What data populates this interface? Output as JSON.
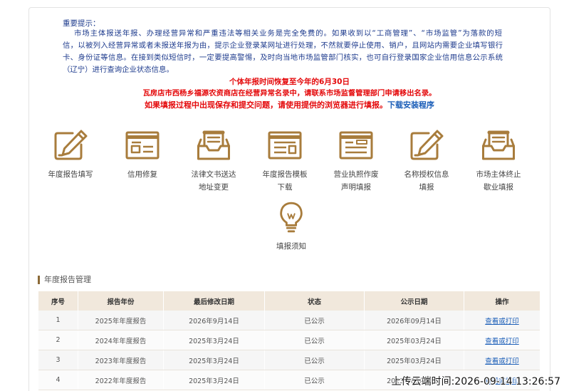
{
  "colors": {
    "notice_text": "#1f3c8e",
    "alert_red": "#e4080a",
    "link_blue": "#1b5eb8",
    "icon_gold": "#a87c3c",
    "accent_bar": "#8c6a38",
    "table_header_bg": "#f1e8dc"
  },
  "notice": {
    "title": "重要提示：",
    "lines": [
      "市场主体报送年报、办理经营异常和严重违法等相关业务是完全免费的。如果收到以“工商管理”、“市场监管”为落款的短",
      "信，以被列入经营异常或者未报送年报为由，提示企业登录某网址进行处理，不然就要停止使用、销户，且网站内需要企业填写银行",
      "卡、身份证等信息。在接到类似短信时，一定要提高警惕，及时向当地市场监管部门核实，也可自行登录国家企业信用信息公示系统",
      "（辽宁）进行查询企业状态信息。"
    ]
  },
  "alerts": {
    "deadline": "个体年报时间恢复至今年的6月30日",
    "abnormal": "瓦房店市西杨乡福源农资商店在经营异常名录中，请联系市场监督管理部门申请移出名录。",
    "browser_hint": "如果填报过程中出现保存和提交问题，请使用提供的浏览器进行填报。",
    "download_link": "下载安装程序"
  },
  "services": [
    {
      "icon": "pen-document-icon",
      "label": "年度报告填写"
    },
    {
      "icon": "window-list-icon",
      "label": "信用修复"
    },
    {
      "icon": "document-tray-icon",
      "label": "法律文书送达地址变更"
    },
    {
      "icon": "window-list-icon",
      "label": "年度报告模板下载"
    },
    {
      "icon": "window-list-icon",
      "label": "营业执照作废声明填报"
    },
    {
      "icon": "pen-document-icon",
      "label": "名称授权信息填报"
    },
    {
      "icon": "document-tray-icon",
      "label": "市场主体终止歇业填报"
    },
    {
      "icon": "lightbulb-icon",
      "label": "填报须知"
    }
  ],
  "annual_reports": {
    "section_title": "年度报告管理",
    "columns": [
      "序号",
      "报告年份",
      "最后修改日期",
      "状态",
      "公示日期",
      "操作"
    ],
    "rows": [
      {
        "index": "1",
        "year": "2025年年度报告",
        "modified": "2026年9月14日",
        "status": "已公示",
        "published": "2026年09月14日",
        "action": "查看或打印"
      },
      {
        "index": "2",
        "year": "2024年年度报告",
        "modified": "2025年3月24日",
        "status": "已公示",
        "published": "2025年03月24日",
        "action": "查看或打印"
      },
      {
        "index": "3",
        "year": "2023年年度报告",
        "modified": "2025年3月24日",
        "status": "已公示",
        "published": "2025年03月24日",
        "action": "查看或打印"
      },
      {
        "index": "4",
        "year": "2022年年度报告",
        "modified": "2025年3月24日",
        "status": "已公示",
        "published": "2025年03月24日",
        "action": "查看或打印"
      }
    ]
  },
  "watermark": "上传云端时间:2026-09-14 13:26:57"
}
